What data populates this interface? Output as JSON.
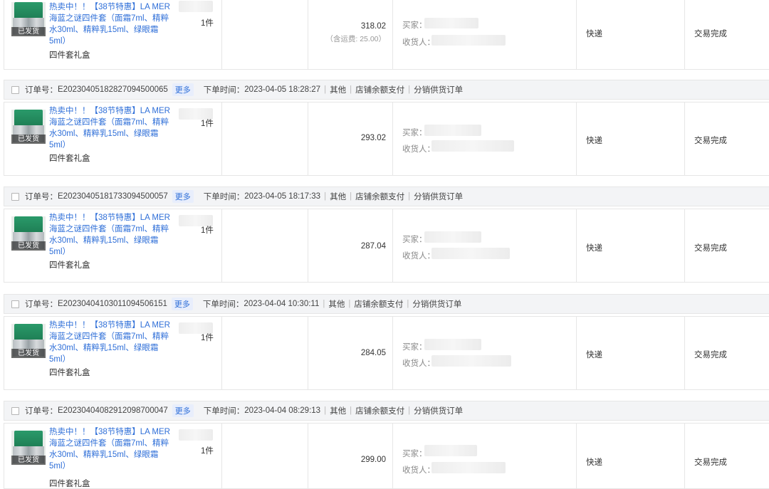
{
  "product": {
    "title": "热卖中！！【38节特惠】LA MER海蓝之谜四件套（面霜7ml、精粹水30ml、精粹乳15ml、绿眼霜5ml）",
    "spec": "四件套礼盒",
    "badge": "已发货",
    "qty": "1件"
  },
  "labels": {
    "order_no": "订单号：",
    "more": "更多",
    "order_time": "下单时间：",
    "buyer": "买家：",
    "receiver": "收货人：",
    "shipping_fee_prefix": "（含运费: ",
    "shipping_fee_suffix": "）"
  },
  "orders": [
    {
      "price": "318.02",
      "shipping_fee": "25.00",
      "delivery": "快递",
      "status": "交易完成"
    },
    {
      "order_no": "E20230405182827094500065",
      "order_time": "2023-04-05 18:28:27",
      "channel": "其他",
      "payment": "店铺余额支付",
      "order_type": "分销供货订单",
      "price": "293.02",
      "delivery": "快递",
      "status": "交易完成"
    },
    {
      "order_no": "E20230405181733094500057",
      "order_time": "2023-04-05 18:17:33",
      "channel": "其他",
      "payment": "店铺余额支付",
      "order_type": "分销供货订单",
      "price": "287.04",
      "delivery": "快递",
      "status": "交易完成"
    },
    {
      "order_no": "E20230404103011094506151",
      "order_time": "2023-04-04 10:30:11",
      "channel": "其他",
      "payment": "店铺余额支付",
      "order_type": "分销供货订单",
      "price": "284.05",
      "delivery": "快递",
      "status": "交易完成"
    },
    {
      "order_no": "E20230404082912098700047",
      "order_time": "2023-04-04 08:29:13",
      "channel": "其他",
      "payment": "店铺余额支付",
      "order_type": "分销供货订单",
      "price": "299.00",
      "delivery": "快递",
      "status": "交易完成"
    }
  ]
}
